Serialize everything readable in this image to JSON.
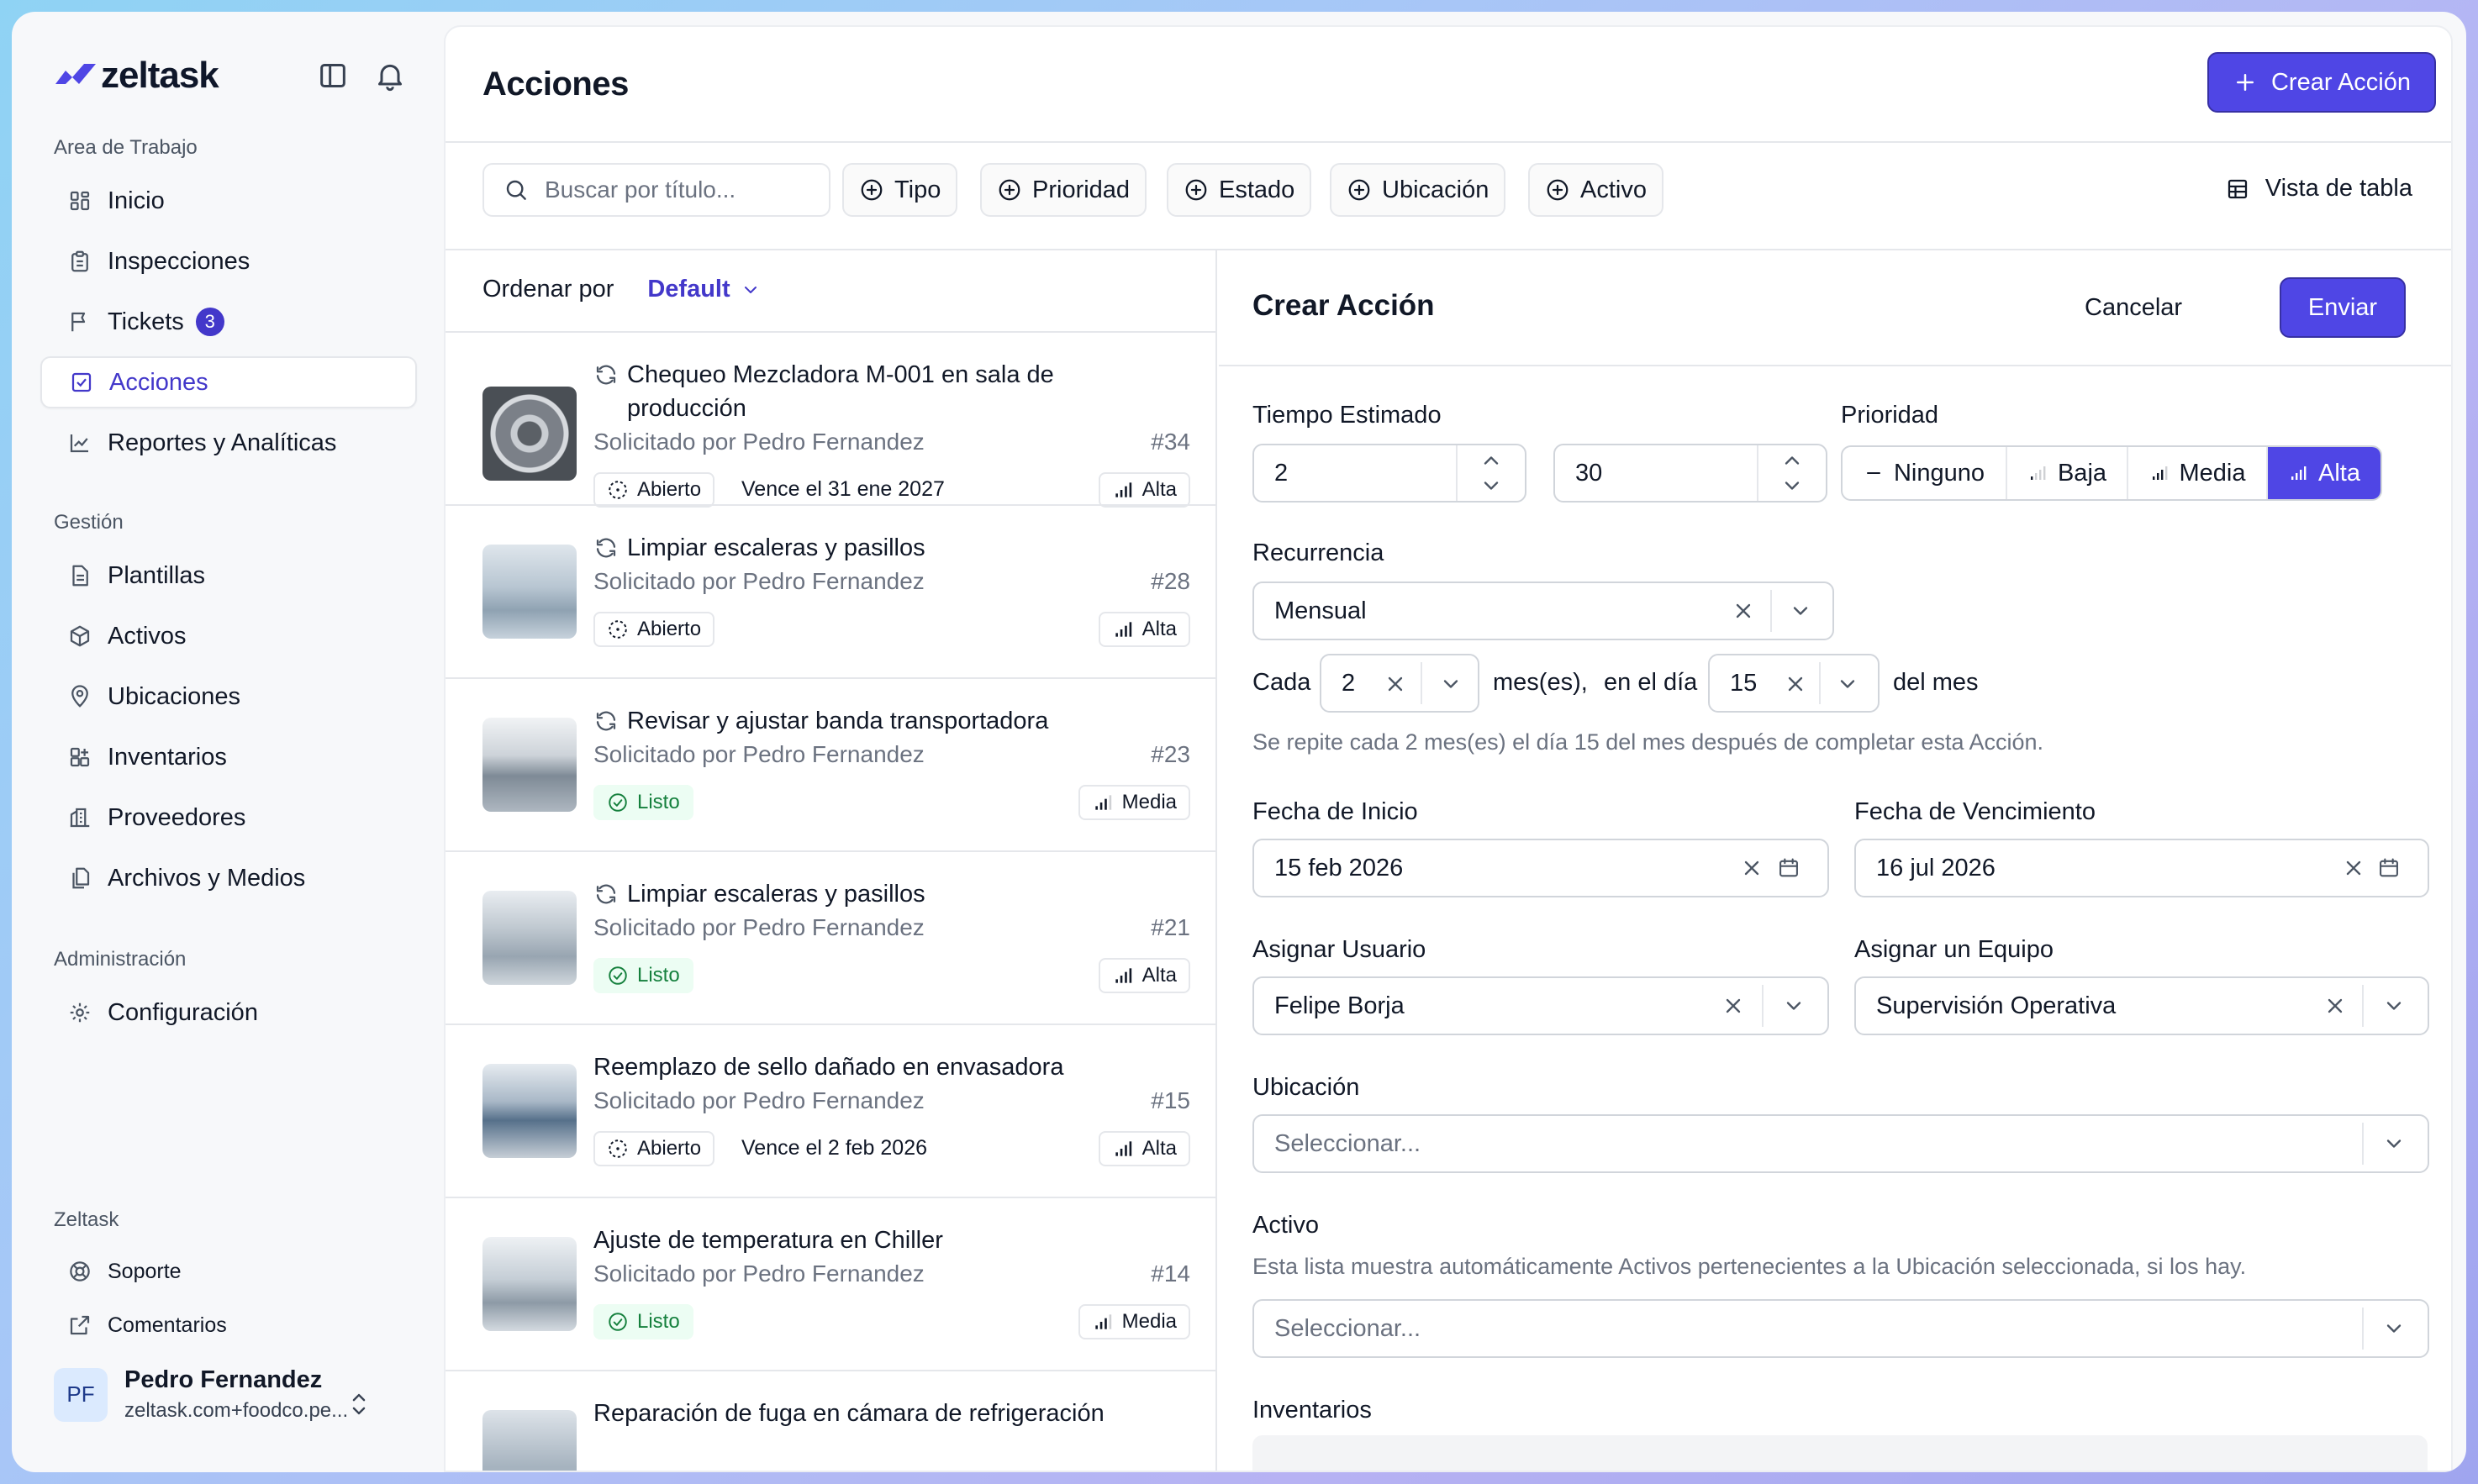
{
  "brand": {
    "name": "zeltask",
    "accent": "#4f46e5"
  },
  "sidebar": {
    "workspace_label": "Area de Trabajo",
    "workspace_items": [
      {
        "label": "Inicio",
        "icon": "dashboard-icon"
      },
      {
        "label": "Inspecciones",
        "icon": "clipboard-icon"
      },
      {
        "label": "Tickets",
        "icon": "flag-icon",
        "badge": "3"
      },
      {
        "label": "Acciones",
        "icon": "check-square-icon",
        "active": true
      },
      {
        "label": "Reportes y Analíticas",
        "icon": "chart-line-icon"
      }
    ],
    "management_label": "Gestión",
    "management_items": [
      {
        "label": "Plantillas",
        "icon": "file-icon"
      },
      {
        "label": "Activos",
        "icon": "box-icon"
      },
      {
        "label": "Ubicaciones",
        "icon": "map-pin-icon"
      },
      {
        "label": "Inventarios",
        "icon": "grid-plus-icon"
      },
      {
        "label": "Proveedores",
        "icon": "building-icon"
      },
      {
        "label": "Archivos y Medios",
        "icon": "files-icon"
      }
    ],
    "admin_label": "Administración",
    "admin_items": [
      {
        "label": "Configuración",
        "icon": "gear-icon"
      }
    ],
    "footer_label": "Zeltask",
    "footer_items": [
      {
        "label": "Soporte",
        "icon": "lifebuoy-icon"
      },
      {
        "label": "Comentarios",
        "icon": "external-link-icon"
      }
    ],
    "user": {
      "initials": "PF",
      "name": "Pedro Fernandez",
      "email": "zeltask.com+foodco.pe..."
    }
  },
  "header": {
    "title": "Acciones",
    "create_label": "Crear Acción"
  },
  "filters": {
    "search_placeholder": "Buscar por título...",
    "chips": [
      "Tipo",
      "Prioridad",
      "Estado",
      "Ubicación",
      "Activo"
    ],
    "table_view_label": "Vista de tabla"
  },
  "list": {
    "sort_label": "Ordenar por",
    "sort_value": "Default",
    "items": [
      {
        "title": "Chequeo Mezcladora M-001 en sala de producción",
        "requested": "Solicitado por Pedro Fernandez",
        "number": "#34",
        "status": "Abierto",
        "due": "Vence el 31 ene 2027",
        "priority": "Alta",
        "recurring": true
      },
      {
        "title": "Limpiar escaleras y pasillos",
        "requested": "Solicitado por Pedro Fernandez",
        "number": "#28",
        "status": "Abierto",
        "due": "",
        "priority": "Alta",
        "recurring": true
      },
      {
        "title": "Revisar y ajustar banda transportadora",
        "requested": "Solicitado por Pedro Fernandez",
        "number": "#23",
        "status": "Listo",
        "due": "",
        "priority": "Media",
        "recurring": true
      },
      {
        "title": "Limpiar escaleras y pasillos",
        "requested": "Solicitado por Pedro Fernandez",
        "number": "#21",
        "status": "Listo",
        "due": "",
        "priority": "Alta",
        "recurring": true
      },
      {
        "title": "Reemplazo de sello dañado en envasadora",
        "requested": "Solicitado por Pedro Fernandez",
        "number": "#15",
        "status": "Abierto",
        "due": "Vence el 2 feb 2026",
        "priority": "Alta",
        "recurring": false
      },
      {
        "title": "Ajuste de temperatura en Chiller",
        "requested": "Solicitado por Pedro Fernandez",
        "number": "#14",
        "status": "Listo",
        "due": "",
        "priority": "Media",
        "recurring": false
      },
      {
        "title": "Reparación de fuga en cámara de refrigeración",
        "requested": "",
        "number": "",
        "status": "",
        "due": "",
        "priority": "",
        "recurring": false
      }
    ]
  },
  "form": {
    "title": "Crear Acción",
    "cancel_label": "Cancelar",
    "submit_label": "Enviar",
    "estimated_time_label": "Tiempo Estimado",
    "hours_value": "2",
    "minutes_value": "30",
    "priority_label": "Prioridad",
    "priority_options": [
      "Ninguno",
      "Baja",
      "Media",
      "Alta"
    ],
    "priority_selected": "Alta",
    "recurrence_label": "Recurrencia",
    "recurrence_value": "Mensual",
    "every_label": "Cada",
    "every_value": "2",
    "months_label": "mes(es),",
    "on_day_label": "en el día",
    "day_value": "15",
    "of_month_label": "del mes",
    "recurrence_help": "Se repite cada 2 mes(es) el día 15 del mes después de completar esta Acción.",
    "start_date_label": "Fecha de Inicio",
    "start_date_value": "15 feb 2026",
    "due_date_label": "Fecha de Vencimiento",
    "due_date_value": "16 jul 2026",
    "assign_user_label": "Asignar Usuario",
    "assign_user_value": "Felipe Borja",
    "assign_team_label": "Asignar un Equipo",
    "assign_team_value": "Supervisión Operativa",
    "location_label": "Ubicación",
    "location_placeholder": "Seleccionar...",
    "asset_label": "Activo",
    "asset_help": "Esta lista muestra automáticamente Activos pertenecientes a la Ubicación seleccionada, si los hay.",
    "asset_placeholder": "Seleccionar...",
    "inventory_label": "Inventarios"
  }
}
